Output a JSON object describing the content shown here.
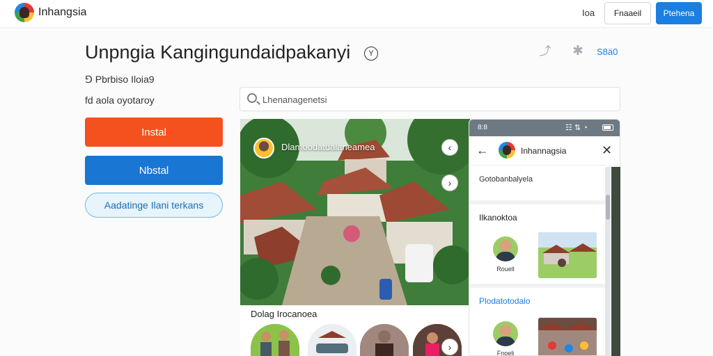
{
  "header": {
    "brand": "Inhangsia",
    "link": "Ioa",
    "outline_button": "Fnaaeil",
    "primary_button": "Ptehena"
  },
  "app": {
    "title": "Unpngia Kangingundaidpakanyi",
    "verify_icon": "Y",
    "rating_link": "S8ä0",
    "meta_line1": "⅁ Pbrbiso Iloia9",
    "meta_line2": "fd aola oyotaroy"
  },
  "actions": {
    "install_red": "Instal",
    "install_blue": "Nbstal",
    "add_wishlist": "Aadatinge Ilani terkans"
  },
  "search": {
    "placeholder": "Lhenanagenetsi"
  },
  "media": {
    "caption": "Dlamoodatdalaneamea",
    "section_label": "Dolag Irocanoea"
  },
  "panel": {
    "status_time": "8:8",
    "status_icons": "☷ ⇅ ◔",
    "title": "Inhannagsia",
    "item1": "Gotobanbalyela",
    "heading1": "Ilkanoktoa",
    "person1": "Rouell",
    "heading2": "Plodatotodalo",
    "person2": "Fnoeli"
  },
  "icons": {
    "logo": "app-logo",
    "verify": "verified-icon",
    "share": "share-icon",
    "settings": "settings-icon",
    "search": "search-icon",
    "back": "back-arrow-icon",
    "close": "close-icon"
  },
  "colors": {
    "primary": "#1a7fe0",
    "install_red": "#f4511e",
    "install_blue": "#1976d2"
  }
}
